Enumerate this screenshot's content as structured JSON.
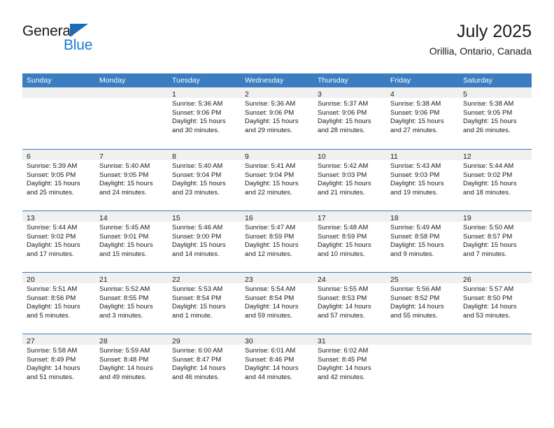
{
  "brand": {
    "name_part1": "General",
    "name_part2": "Blue",
    "triangle_color": "#1b6cb5",
    "text_color": "#1b7ad1"
  },
  "header": {
    "title": "July 2025",
    "subtitle": "Orillia, Ontario, Canada"
  },
  "theme": {
    "header_bg": "#3a7dc0",
    "day_strip_bg": "#f0f0f0",
    "page_bg": "#ffffff"
  },
  "weekdays": [
    "Sunday",
    "Monday",
    "Tuesday",
    "Wednesday",
    "Thursday",
    "Friday",
    "Saturday"
  ],
  "labels": {
    "sunrise_prefix": "Sunrise:",
    "sunset_prefix": "Sunset:",
    "daylight_prefix": "Daylight:"
  },
  "weeks": [
    [
      {
        "day": "",
        "sunrise": "",
        "sunset": "",
        "daylight_line1": "",
        "daylight_line2": ""
      },
      {
        "day": "",
        "sunrise": "",
        "sunset": "",
        "daylight_line1": "",
        "daylight_line2": ""
      },
      {
        "day": "1",
        "sunrise": "Sunrise: 5:36 AM",
        "sunset": "Sunset: 9:06 PM",
        "daylight_line1": "Daylight: 15 hours",
        "daylight_line2": "and 30 minutes."
      },
      {
        "day": "2",
        "sunrise": "Sunrise: 5:36 AM",
        "sunset": "Sunset: 9:06 PM",
        "daylight_line1": "Daylight: 15 hours",
        "daylight_line2": "and 29 minutes."
      },
      {
        "day": "3",
        "sunrise": "Sunrise: 5:37 AM",
        "sunset": "Sunset: 9:06 PM",
        "daylight_line1": "Daylight: 15 hours",
        "daylight_line2": "and 28 minutes."
      },
      {
        "day": "4",
        "sunrise": "Sunrise: 5:38 AM",
        "sunset": "Sunset: 9:06 PM",
        "daylight_line1": "Daylight: 15 hours",
        "daylight_line2": "and 27 minutes."
      },
      {
        "day": "5",
        "sunrise": "Sunrise: 5:38 AM",
        "sunset": "Sunset: 9:05 PM",
        "daylight_line1": "Daylight: 15 hours",
        "daylight_line2": "and 26 minutes."
      }
    ],
    [
      {
        "day": "6",
        "sunrise": "Sunrise: 5:39 AM",
        "sunset": "Sunset: 9:05 PM",
        "daylight_line1": "Daylight: 15 hours",
        "daylight_line2": "and 25 minutes."
      },
      {
        "day": "7",
        "sunrise": "Sunrise: 5:40 AM",
        "sunset": "Sunset: 9:05 PM",
        "daylight_line1": "Daylight: 15 hours",
        "daylight_line2": "and 24 minutes."
      },
      {
        "day": "8",
        "sunrise": "Sunrise: 5:40 AM",
        "sunset": "Sunset: 9:04 PM",
        "daylight_line1": "Daylight: 15 hours",
        "daylight_line2": "and 23 minutes."
      },
      {
        "day": "9",
        "sunrise": "Sunrise: 5:41 AM",
        "sunset": "Sunset: 9:04 PM",
        "daylight_line1": "Daylight: 15 hours",
        "daylight_line2": "and 22 minutes."
      },
      {
        "day": "10",
        "sunrise": "Sunrise: 5:42 AM",
        "sunset": "Sunset: 9:03 PM",
        "daylight_line1": "Daylight: 15 hours",
        "daylight_line2": "and 21 minutes."
      },
      {
        "day": "11",
        "sunrise": "Sunrise: 5:43 AM",
        "sunset": "Sunset: 9:03 PM",
        "daylight_line1": "Daylight: 15 hours",
        "daylight_line2": "and 19 minutes."
      },
      {
        "day": "12",
        "sunrise": "Sunrise: 5:44 AM",
        "sunset": "Sunset: 9:02 PM",
        "daylight_line1": "Daylight: 15 hours",
        "daylight_line2": "and 18 minutes."
      }
    ],
    [
      {
        "day": "13",
        "sunrise": "Sunrise: 5:44 AM",
        "sunset": "Sunset: 9:02 PM",
        "daylight_line1": "Daylight: 15 hours",
        "daylight_line2": "and 17 minutes."
      },
      {
        "day": "14",
        "sunrise": "Sunrise: 5:45 AM",
        "sunset": "Sunset: 9:01 PM",
        "daylight_line1": "Daylight: 15 hours",
        "daylight_line2": "and 15 minutes."
      },
      {
        "day": "15",
        "sunrise": "Sunrise: 5:46 AM",
        "sunset": "Sunset: 9:00 PM",
        "daylight_line1": "Daylight: 15 hours",
        "daylight_line2": "and 14 minutes."
      },
      {
        "day": "16",
        "sunrise": "Sunrise: 5:47 AM",
        "sunset": "Sunset: 8:59 PM",
        "daylight_line1": "Daylight: 15 hours",
        "daylight_line2": "and 12 minutes."
      },
      {
        "day": "17",
        "sunrise": "Sunrise: 5:48 AM",
        "sunset": "Sunset: 8:59 PM",
        "daylight_line1": "Daylight: 15 hours",
        "daylight_line2": "and 10 minutes."
      },
      {
        "day": "18",
        "sunrise": "Sunrise: 5:49 AM",
        "sunset": "Sunset: 8:58 PM",
        "daylight_line1": "Daylight: 15 hours",
        "daylight_line2": "and 9 minutes."
      },
      {
        "day": "19",
        "sunrise": "Sunrise: 5:50 AM",
        "sunset": "Sunset: 8:57 PM",
        "daylight_line1": "Daylight: 15 hours",
        "daylight_line2": "and 7 minutes."
      }
    ],
    [
      {
        "day": "20",
        "sunrise": "Sunrise: 5:51 AM",
        "sunset": "Sunset: 8:56 PM",
        "daylight_line1": "Daylight: 15 hours",
        "daylight_line2": "and 5 minutes."
      },
      {
        "day": "21",
        "sunrise": "Sunrise: 5:52 AM",
        "sunset": "Sunset: 8:55 PM",
        "daylight_line1": "Daylight: 15 hours",
        "daylight_line2": "and 3 minutes."
      },
      {
        "day": "22",
        "sunrise": "Sunrise: 5:53 AM",
        "sunset": "Sunset: 8:54 PM",
        "daylight_line1": "Daylight: 15 hours",
        "daylight_line2": "and 1 minute."
      },
      {
        "day": "23",
        "sunrise": "Sunrise: 5:54 AM",
        "sunset": "Sunset: 8:54 PM",
        "daylight_line1": "Daylight: 14 hours",
        "daylight_line2": "and 59 minutes."
      },
      {
        "day": "24",
        "sunrise": "Sunrise: 5:55 AM",
        "sunset": "Sunset: 8:53 PM",
        "daylight_line1": "Daylight: 14 hours",
        "daylight_line2": "and 57 minutes."
      },
      {
        "day": "25",
        "sunrise": "Sunrise: 5:56 AM",
        "sunset": "Sunset: 8:52 PM",
        "daylight_line1": "Daylight: 14 hours",
        "daylight_line2": "and 55 minutes."
      },
      {
        "day": "26",
        "sunrise": "Sunrise: 5:57 AM",
        "sunset": "Sunset: 8:50 PM",
        "daylight_line1": "Daylight: 14 hours",
        "daylight_line2": "and 53 minutes."
      }
    ],
    [
      {
        "day": "27",
        "sunrise": "Sunrise: 5:58 AM",
        "sunset": "Sunset: 8:49 PM",
        "daylight_line1": "Daylight: 14 hours",
        "daylight_line2": "and 51 minutes."
      },
      {
        "day": "28",
        "sunrise": "Sunrise: 5:59 AM",
        "sunset": "Sunset: 8:48 PM",
        "daylight_line1": "Daylight: 14 hours",
        "daylight_line2": "and 49 minutes."
      },
      {
        "day": "29",
        "sunrise": "Sunrise: 6:00 AM",
        "sunset": "Sunset: 8:47 PM",
        "daylight_line1": "Daylight: 14 hours",
        "daylight_line2": "and 46 minutes."
      },
      {
        "day": "30",
        "sunrise": "Sunrise: 6:01 AM",
        "sunset": "Sunset: 8:46 PM",
        "daylight_line1": "Daylight: 14 hours",
        "daylight_line2": "and 44 minutes."
      },
      {
        "day": "31",
        "sunrise": "Sunrise: 6:02 AM",
        "sunset": "Sunset: 8:45 PM",
        "daylight_line1": "Daylight: 14 hours",
        "daylight_line2": "and 42 minutes."
      },
      {
        "day": "",
        "sunrise": "",
        "sunset": "",
        "daylight_line1": "",
        "daylight_line2": ""
      },
      {
        "day": "",
        "sunrise": "",
        "sunset": "",
        "daylight_line1": "",
        "daylight_line2": ""
      }
    ]
  ]
}
